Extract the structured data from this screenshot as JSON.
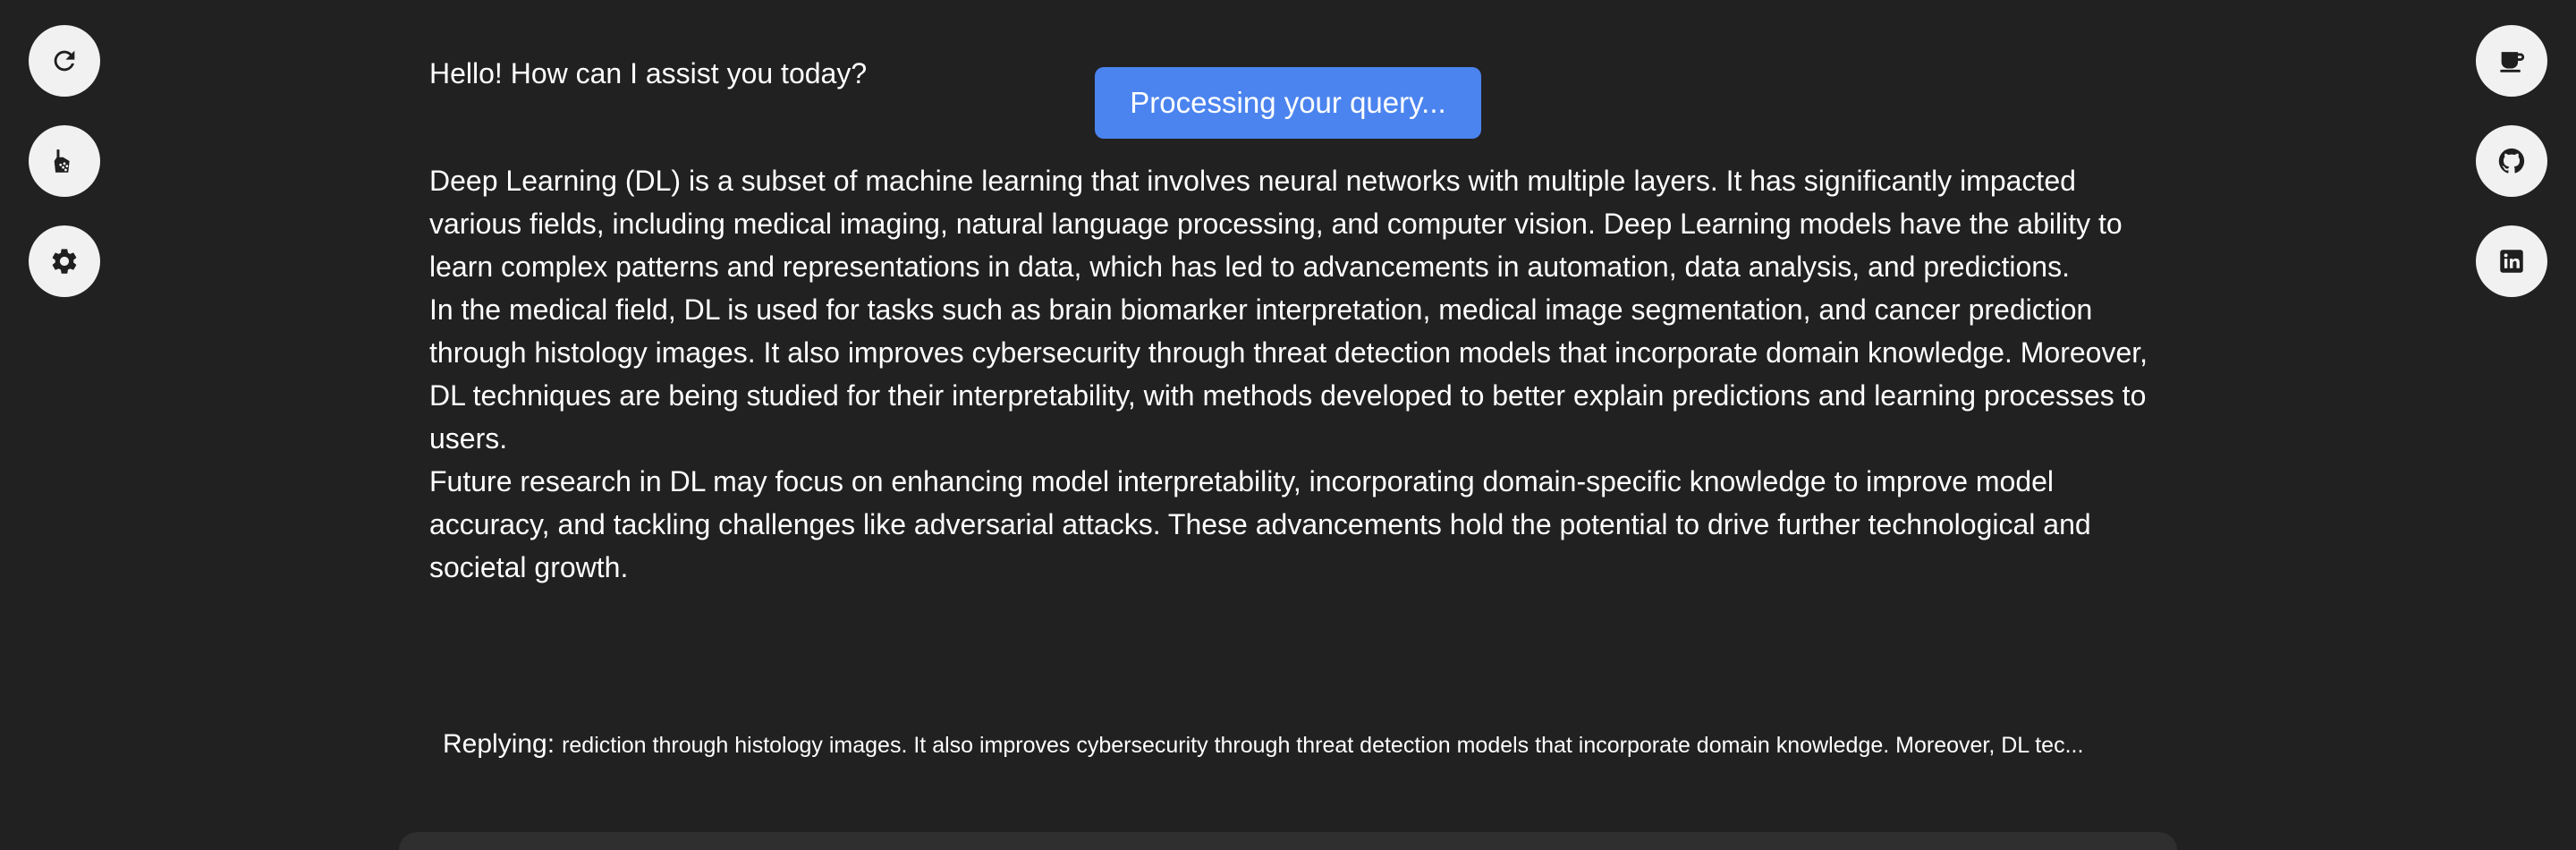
{
  "sidebar_left": {
    "buttons": [
      {
        "icon": "refresh-icon"
      },
      {
        "icon": "broom-icon"
      },
      {
        "icon": "gear-icon"
      }
    ]
  },
  "sidebar_right": {
    "buttons": [
      {
        "icon": "coffee-cup-icon"
      },
      {
        "icon": "github-icon"
      },
      {
        "icon": "linkedin-icon"
      }
    ]
  },
  "chat": {
    "greeting": "Hello! How can I assist you today?",
    "answer_paragraphs": [
      "Deep Learning (DL) is a subset of machine learning that involves neural networks with multiple layers. It has significantly impacted various fields, including medical imaging, natural language processing, and computer vision. Deep Learning models have the ability to learn complex patterns and representations in data, which has led to advancements in automation, data analysis, and predictions.",
      "In the medical field, DL is used for tasks such as brain biomarker interpretation, medical image segmentation, and cancer prediction through histology images. It also improves cybersecurity through threat detection models that incorporate domain knowledge. Moreover, DL techniques are being studied for their interpretability, with methods developed to better explain predictions and learning processes to users.",
      "Future research in DL may focus on enhancing model interpretability, incorporating domain-specific knowledge to improve model accuracy, and tackling challenges like adversarial attacks. These advancements hold the potential to drive further technological and societal growth."
    ]
  },
  "status": {
    "processing": "Processing your query..."
  },
  "replying": {
    "label": "Replying:",
    "text": "rediction through histology images. It also improves cybersecurity through threat detection models that incorporate domain knowledge. Moreover, DL tec..."
  },
  "colors": {
    "background": "#212121",
    "accent": "#4b84ef",
    "button_bg": "#f1f1f1",
    "icon": "#1f1f1f"
  }
}
